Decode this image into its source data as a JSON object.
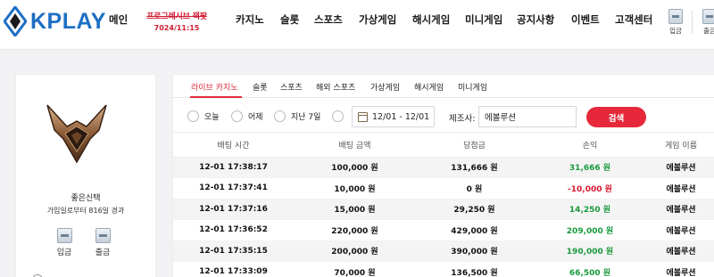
{
  "header": {
    "logo_text": "KPLAY",
    "nav": [
      "메인",
      "카지노",
      "슬롯",
      "스포츠",
      "가상게임",
      "해시게임",
      "미니게임",
      "공지사항",
      "이벤트",
      "고객센터"
    ],
    "promo": {
      "line1": "프로그레시브 잭팟",
      "line2": "7024/11:15"
    },
    "quick_buttons": {
      "deposit": "입금",
      "withdraw": "출금"
    },
    "accent_color": "#1d6fc4"
  },
  "profile": {
    "nickname": "좋은신택",
    "join_info": "가입일로부터 816일 경과",
    "deposit_label": "입금",
    "withdraw_label": "출금"
  },
  "tabs": [
    "라이브 카지노",
    "슬롯",
    "스포츠",
    "해외 스포츠",
    "가상게임",
    "해시게임",
    "미니게임"
  ],
  "active_tab": "라이브 카지노",
  "filters": {
    "periods": [
      "오늘",
      "어제",
      "지난 7일",
      ""
    ],
    "date_range": "12/01 - 12/01",
    "provider_label": "제조사:",
    "provider_value": "에볼루션",
    "search_label": "검색",
    "search_color": "#e6283a"
  },
  "table": {
    "columns": [
      "배팅 시간",
      "배팅 금액",
      "당첨금",
      "손익",
      "게임 이름"
    ],
    "rows": [
      {
        "time": "12-01 17:38:17",
        "bet": "100,000 원",
        "win": "131,666 원",
        "pl": "31,666 원",
        "pl_sign": "pos",
        "game": "에볼루션"
      },
      {
        "time": "12-01 17:37:41",
        "bet": "10,000 원",
        "win": "0 원",
        "pl": "-10,000 원",
        "pl_sign": "neg",
        "game": "에볼루션"
      },
      {
        "time": "12-01 17:37:16",
        "bet": "15,000 원",
        "win": "29,250 원",
        "pl": "14,250 원",
        "pl_sign": "pos",
        "game": "에볼루션"
      },
      {
        "time": "12-01 17:36:52",
        "bet": "220,000 원",
        "win": "429,000 원",
        "pl": "209,000 원",
        "pl_sign": "pos",
        "game": "에볼루션"
      },
      {
        "time": "12-01 17:35:15",
        "bet": "200,000 원",
        "win": "390,000 원",
        "pl": "190,000 원",
        "pl_sign": "pos",
        "game": "에볼루션"
      },
      {
        "time": "12-01 17:33:09",
        "bet": "70,000 원",
        "win": "136,500 원",
        "pl": "66,500 원",
        "pl_sign": "pos",
        "game": "에볼루션"
      }
    ],
    "positive_color": "#199a3c",
    "negative_color": "#d9182e"
  }
}
